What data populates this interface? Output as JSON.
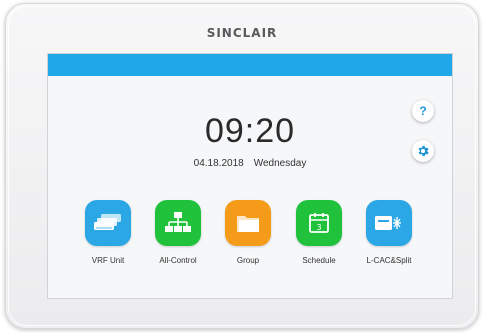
{
  "brand": "SINCLAIR",
  "clock": {
    "time": "09:20",
    "date": "04.18.2018",
    "weekday": "Wednesday"
  },
  "side_buttons": {
    "help_label": "?",
    "help_icon": "question-icon",
    "settings_icon": "gear-icon"
  },
  "tiles": [
    {
      "label": "VRF Unit",
      "icon": "indoor-units-icon",
      "color": "#2aa7e4"
    },
    {
      "label": "All-Control",
      "icon": "hierarchy-icon",
      "color": "#1fc23a"
    },
    {
      "label": "Group",
      "icon": "folder-icon",
      "color": "#f59b1a"
    },
    {
      "label": "Schedule",
      "icon": "calendar-icon",
      "color": "#1fc23a"
    },
    {
      "label": "L-CAC&Split",
      "icon": "ac-split-icon",
      "color": "#2aa7e4"
    }
  ],
  "colors": {
    "top_bar": "#1ea8e8",
    "accent": "#1f97d6"
  }
}
